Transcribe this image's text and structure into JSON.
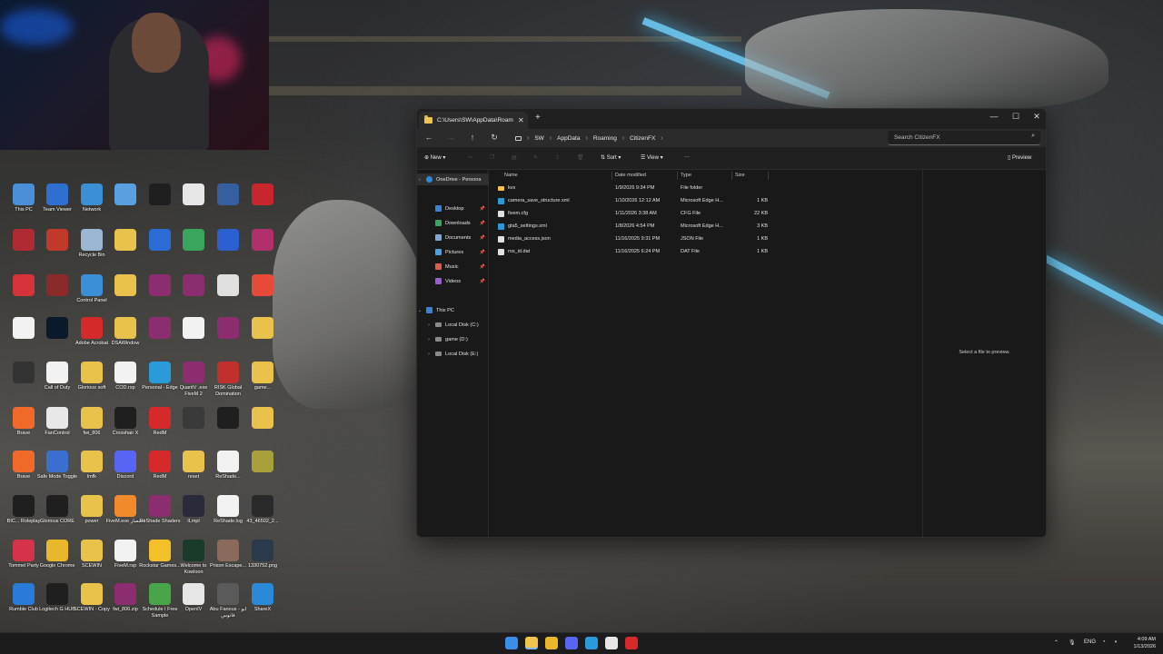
{
  "desktop": {
    "icons": [
      {
        "label": "This PC",
        "color": "#4a8fd8"
      },
      {
        "label": "Team Viewer",
        "color": "#2f6fcf"
      },
      {
        "label": "Network",
        "color": "#3b8fd4"
      },
      {
        "label": "",
        "color": "#5aa0e0"
      },
      {
        "label": "",
        "color": "#1f1f1f"
      },
      {
        "label": "",
        "color": "#e6e6e6"
      },
      {
        "label": "",
        "color": "#3560a0"
      },
      {
        "label": "",
        "color": "#c8262c"
      },
      {
        "label": "",
        "color": "#b02a34"
      },
      {
        "label": "",
        "color": "#c0392b"
      },
      {
        "label": "Recycle Bin",
        "color": "#9bb7d4"
      },
      {
        "label": "",
        "color": "#e8c24a"
      },
      {
        "label": "",
        "color": "#2b6bd6"
      },
      {
        "label": "",
        "color": "#3aa55c"
      },
      {
        "label": "",
        "color": "#2c5fcf"
      },
      {
        "label": "",
        "color": "#b0306b"
      },
      {
        "label": "",
        "color": "#d6323a"
      },
      {
        "label": "",
        "color": "#8a2a2a"
      },
      {
        "label": "Control Panel",
        "color": "#3a8fd6"
      },
      {
        "label": "",
        "color": "#e8c24a"
      },
      {
        "label": "",
        "color": "#8b2d6e"
      },
      {
        "label": "",
        "color": "#8b2d6e"
      },
      {
        "label": "",
        "color": "#e0e0e0"
      },
      {
        "label": "",
        "color": "#e84a3a"
      },
      {
        "label": "",
        "color": "#f2f2f2"
      },
      {
        "label": "",
        "color": "#0b1a2a"
      },
      {
        "label": "Adobe Acrobat",
        "color": "#d42a2a"
      },
      {
        "label": "DSAWindow",
        "color": "#e8c24a"
      },
      {
        "label": "",
        "color": "#8b2d6e"
      },
      {
        "label": "",
        "color": "#f2f2f2"
      },
      {
        "label": "",
        "color": "#8b2d6e"
      },
      {
        "label": "",
        "color": "#e8c24a"
      },
      {
        "label": "",
        "color": "#333333"
      },
      {
        "label": "Call of Duty",
        "color": "#f2f2f2"
      },
      {
        "label": "Glorious soft",
        "color": "#e8c24a"
      },
      {
        "label": "COD.rsp",
        "color": "#f2f2f2"
      },
      {
        "label": "Personal - Edge",
        "color": "#2a9ad8"
      },
      {
        "label": "QuantV .exe FiveM 2",
        "color": "#8b2d6e"
      },
      {
        "label": "RISK Global Domination",
        "color": "#c0302c"
      },
      {
        "label": "game...",
        "color": "#e8c24a"
      },
      {
        "label": "Brave",
        "color": "#f06a2a"
      },
      {
        "label": "FanControl",
        "color": "#e8e8e8"
      },
      {
        "label": "fwi_806",
        "color": "#e8c24a"
      },
      {
        "label": "Crosshair X",
        "color": "#1f1f1f"
      },
      {
        "label": "RedM",
        "color": "#d62a2a"
      },
      {
        "label": "",
        "color": "#3a3a3a"
      },
      {
        "label": "",
        "color": "#1f1f1f"
      },
      {
        "label": "",
        "color": "#e8c24a"
      },
      {
        "label": "Brave",
        "color": "#f06a2a"
      },
      {
        "label": "Safe Mode Toggle",
        "color": "#3a6fd0"
      },
      {
        "label": "lmfk",
        "color": "#e8c24a"
      },
      {
        "label": "Discord",
        "color": "#5865f2"
      },
      {
        "label": "RedM",
        "color": "#d62a2a"
      },
      {
        "label": "reset",
        "color": "#e8c24a"
      },
      {
        "label": "ReShade...",
        "color": "#f2f2f2"
      },
      {
        "label": "",
        "color": "#a8a03a"
      },
      {
        "label": "BIC... Roleplay",
        "color": "#1f1f1f"
      },
      {
        "label": "Glorious CORE",
        "color": "#1f1f1f"
      },
      {
        "label": "power",
        "color": "#e8c24a"
      },
      {
        "label": "FiveM.exe اختصار",
        "color": "#f08a2a"
      },
      {
        "label": "ReShade Shaders",
        "color": "#8b2d6e"
      },
      {
        "label": "ILmpl",
        "color": "#2a2a3a"
      },
      {
        "label": "ReShade.log",
        "color": "#f2f2f2"
      },
      {
        "label": "43_46502_2...",
        "color": "#2a2a2a"
      },
      {
        "label": "Tommel Party",
        "color": "#d6324a"
      },
      {
        "label": "Google Chrome",
        "color": "#e8b72a"
      },
      {
        "label": "SCEWIN",
        "color": "#e8c24a"
      },
      {
        "label": "FiveM.rsp",
        "color": "#f2f2f2"
      },
      {
        "label": "Rockstar Games...",
        "color": "#f2c12a"
      },
      {
        "label": "Welcome to Kowloon",
        "color": "#1a3a2a"
      },
      {
        "label": "Prison Escape...",
        "color": "#8a6a5a"
      },
      {
        "label": "1330752.png",
        "color": "#2a3a4a"
      },
      {
        "label": "Rumble Club",
        "color": "#2a7ad8"
      },
      {
        "label": "Logitech G HUB",
        "color": "#1f1f1f"
      },
      {
        "label": "SCEWIN - Copy",
        "color": "#e8c24a"
      },
      {
        "label": "fwi_806.zip",
        "color": "#8b2d6e"
      },
      {
        "label": "Schedule I Free Sample",
        "color": "#4aa54a"
      },
      {
        "label": "OpenIV",
        "color": "#e6e6e6"
      },
      {
        "label": "Abu Fanous - ابو فانوس",
        "color": "#5a5a5a"
      },
      {
        "label": "ShareX",
        "color": "#2a8ad8"
      }
    ]
  },
  "explorer": {
    "tab_title": "C:\\Users\\SW\\AppData\\Roami",
    "breadcrumb": [
      "SW",
      "AppData",
      "Roaming",
      "CitizenFX"
    ],
    "search_placeholder": "Search CitizenFX",
    "toolbar": {
      "new_label": "New",
      "sort_label": "Sort",
      "view_label": "View",
      "more_label": "···",
      "preview_label": "Preview"
    },
    "nav_pane": {
      "onedrive": "OneDrive - Persona",
      "quick": [
        {
          "label": "Desktop",
          "color": "#3b82d6"
        },
        {
          "label": "Downloads",
          "color": "#3aa55c"
        },
        {
          "label": "Documents",
          "color": "#7fa8d8"
        },
        {
          "label": "Pictures",
          "color": "#4aa0e0"
        },
        {
          "label": "Music",
          "color": "#e05a4a"
        },
        {
          "label": "Videos",
          "color": "#9b5ad6"
        }
      ],
      "this_pc": "This PC",
      "drives": [
        "Local Disk (C:)",
        "game (D:)",
        "Local Disk (E:)"
      ]
    },
    "columns": {
      "name": "Name",
      "date": "Date modified",
      "type": "Type",
      "size": "Size"
    },
    "files": [
      {
        "name": "kvs",
        "date": "1/9/2026 9:34 PM",
        "type": "File folder",
        "size": "",
        "icon_color": "#f3c44b"
      },
      {
        "name": "camera_save_structure.xml",
        "date": "1/10/2026 12:12 AM",
        "type": "Microsoft Edge H...",
        "size": "1 KB",
        "icon_color": "#2a9ad8"
      },
      {
        "name": "fivem.cfg",
        "date": "1/11/2026 3:38 AM",
        "type": "CFG File",
        "size": "22 KB",
        "icon_color": "#e0e0e0"
      },
      {
        "name": "gta5_settings.xml",
        "date": "1/8/2026 4:54 PM",
        "type": "Microsoft Edge H...",
        "size": "3 KB",
        "icon_color": "#2a9ad8"
      },
      {
        "name": "media_access.json",
        "date": "11/16/2025 9:31 PM",
        "type": "JSON File",
        "size": "1 KB",
        "icon_color": "#e0e0e0"
      },
      {
        "name": "ros_id.dat",
        "date": "11/16/2025 6:24 PM",
        "type": "DAT File",
        "size": "1 KB",
        "icon_color": "#e0e0e0"
      }
    ],
    "preview_message": "Select a file to preview."
  },
  "taskbar": {
    "apps": [
      {
        "name": "start",
        "color": "#3b8ee8"
      },
      {
        "name": "file-explorer",
        "color": "#f3c44b"
      },
      {
        "name": "chrome",
        "color": "#e8b72a"
      },
      {
        "name": "discord",
        "color": "#5865f2"
      },
      {
        "name": "edge",
        "color": "#2a9ad8"
      },
      {
        "name": "obs",
        "color": "#e6e6e6"
      },
      {
        "name": "app",
        "color": "#d62a2a"
      }
    ],
    "language": "ENG",
    "time": "4:09 AM",
    "date": "1/13/2026"
  }
}
